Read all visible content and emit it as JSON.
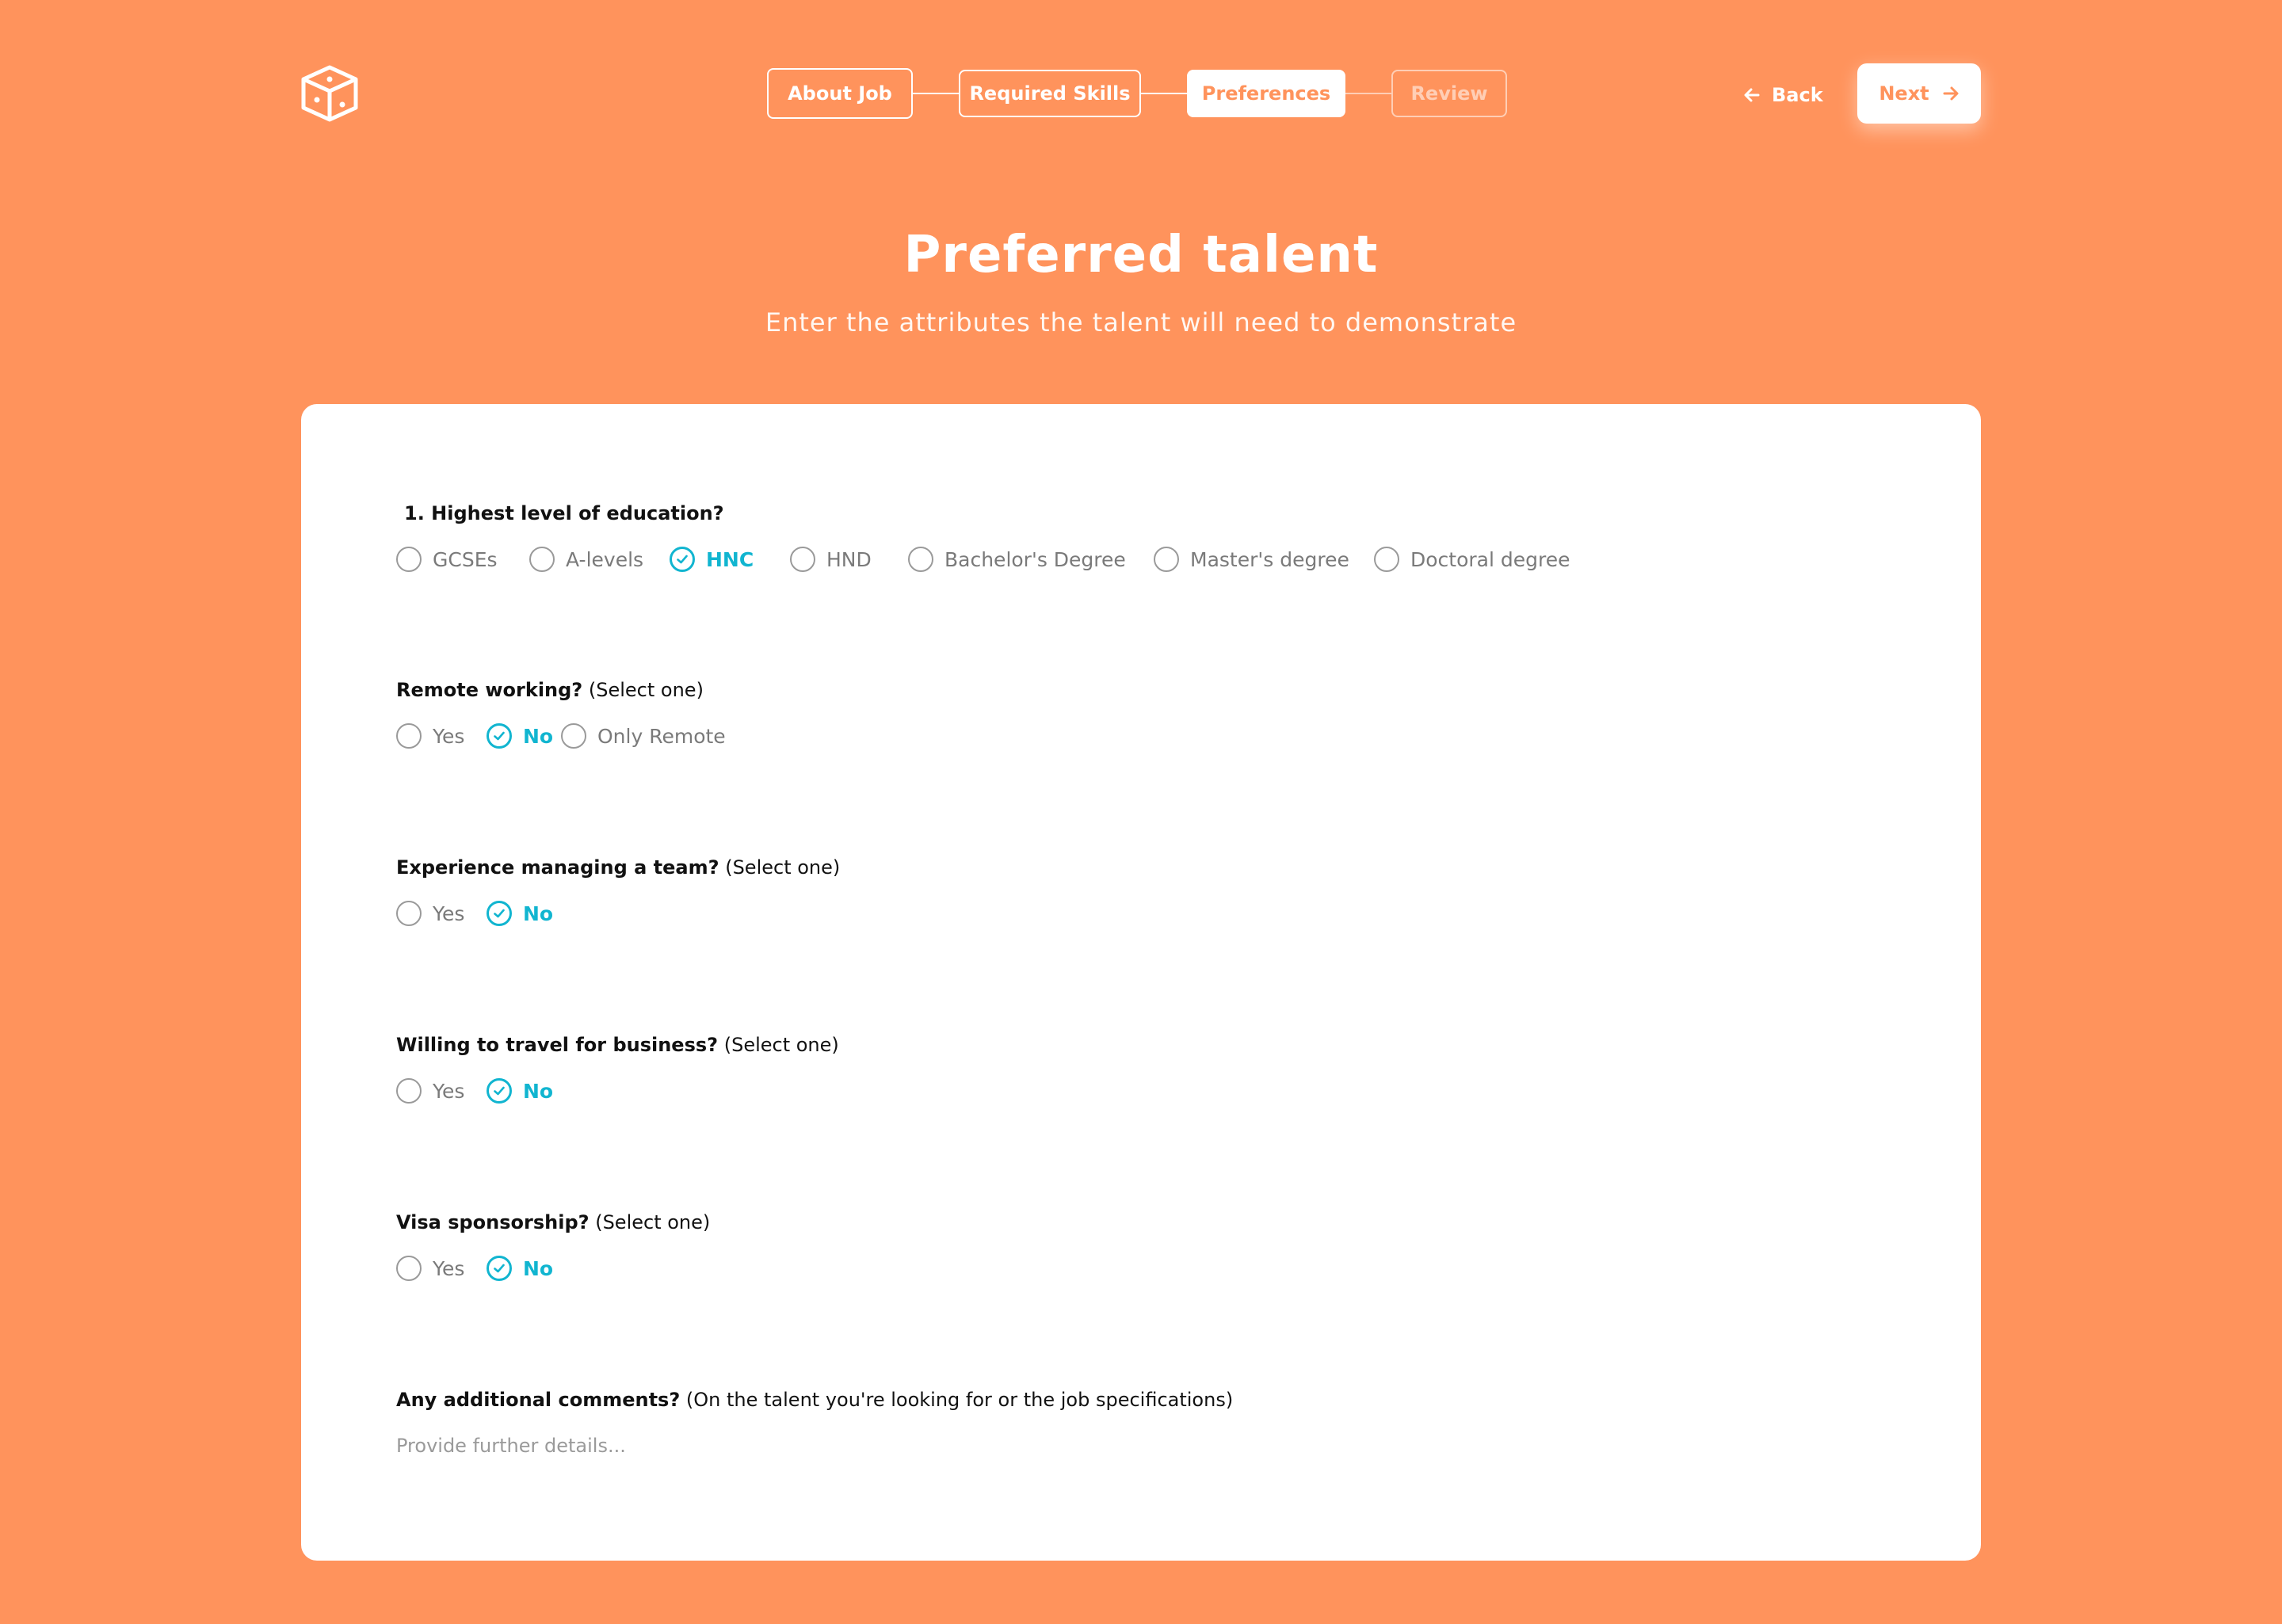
{
  "colors": {
    "background": "#FF935C",
    "accent": "#11B5D0",
    "card": "#FFFFFF"
  },
  "header": {
    "logo_icon": "cube-dice-icon",
    "steps": [
      {
        "label": "About Job",
        "state": "completed"
      },
      {
        "label": "Required Skills",
        "state": "completed"
      },
      {
        "label": "Preferences",
        "state": "active"
      },
      {
        "label": "Review",
        "state": "upcoming"
      }
    ],
    "back_label": "Back",
    "back_icon": "arrow-left-icon",
    "next_label": "Next",
    "next_icon": "arrow-right-icon"
  },
  "page": {
    "title": "Preferred talent",
    "subtitle": "Enter the attributes the talent will need to demonstrate"
  },
  "form": {
    "education": {
      "label": "1. Highest level of education?",
      "options": [
        "GCSEs",
        "A-levels",
        "HNC",
        "HND",
        "Bachelor's Degree",
        "Master's degree",
        "Doctoral degree"
      ],
      "selected": "HNC"
    },
    "remote": {
      "label": "Remote working?",
      "hint": "(Select one)",
      "options": [
        "Yes",
        "No",
        "Only Remote"
      ],
      "selected": "No"
    },
    "team": {
      "label": "Experience managing a team?",
      "hint": "(Select one)",
      "options": [
        "Yes",
        "No"
      ],
      "selected": "No"
    },
    "travel": {
      "label": "Willing to travel for business?",
      "hint": "(Select one)",
      "options": [
        "Yes",
        "No"
      ],
      "selected": "No"
    },
    "visa": {
      "label": "Visa sponsorship?",
      "hint": "(Select one)",
      "options": [
        "Yes",
        "No"
      ],
      "selected": "No"
    },
    "comments": {
      "label": "Any additional comments?",
      "hint": "(On the talent you're looking for or the job specifications)",
      "placeholder": "Provide further details...",
      "value": ""
    }
  }
}
